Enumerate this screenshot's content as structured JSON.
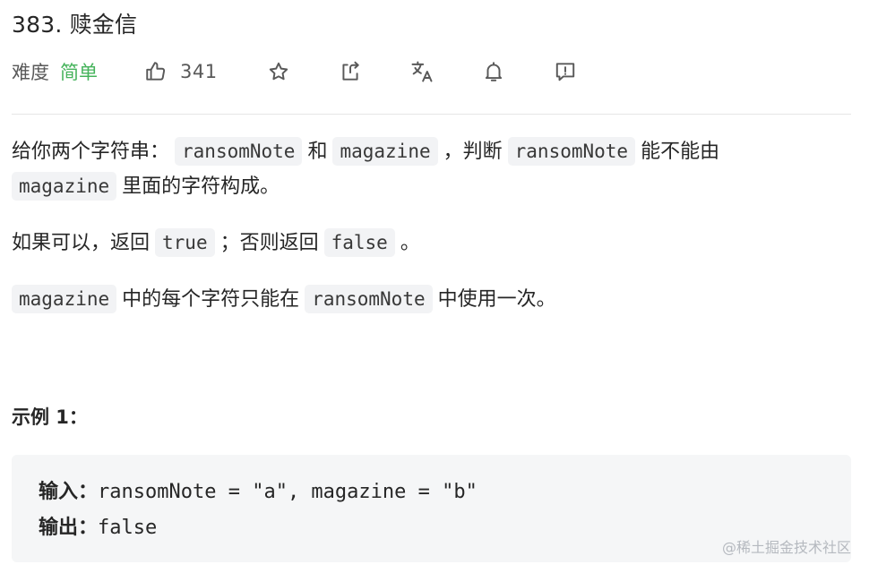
{
  "problem": {
    "title": "383. 赎金信"
  },
  "meta": {
    "difficulty_label": "难度",
    "difficulty_value": "简单",
    "like_count": "341",
    "icons": [
      "thumbs-up-icon",
      "star-icon",
      "share-icon",
      "translate-icon",
      "bell-icon",
      "feedback-icon"
    ],
    "difficulty_color": "#45b35b"
  },
  "description": {
    "p1": {
      "t1": "给你两个字符串：",
      "c1": "ransomNote",
      "t2": "和",
      "c2": "magazine",
      "t3": "，判断",
      "c3": "ransomNote",
      "t4": "能不能由",
      "c4": "magazine",
      "t5": "里面的字符构成。"
    },
    "p2": {
      "t1": "如果可以，返回",
      "c1": "true",
      "t2": "；否则返回",
      "c2": "false",
      "t3": "。"
    },
    "p3": {
      "c1": "magazine",
      "t1": "中的每个字符只能在",
      "c2": "ransomNote",
      "t2": "中使用一次。"
    }
  },
  "example": {
    "title": "示例 1：",
    "input_label": "输入：",
    "input_value": "ransomNote = \"a\", magazine = \"b\"",
    "output_label": "输出：",
    "output_value": "false"
  },
  "watermark": "@稀土掘金技术社区"
}
